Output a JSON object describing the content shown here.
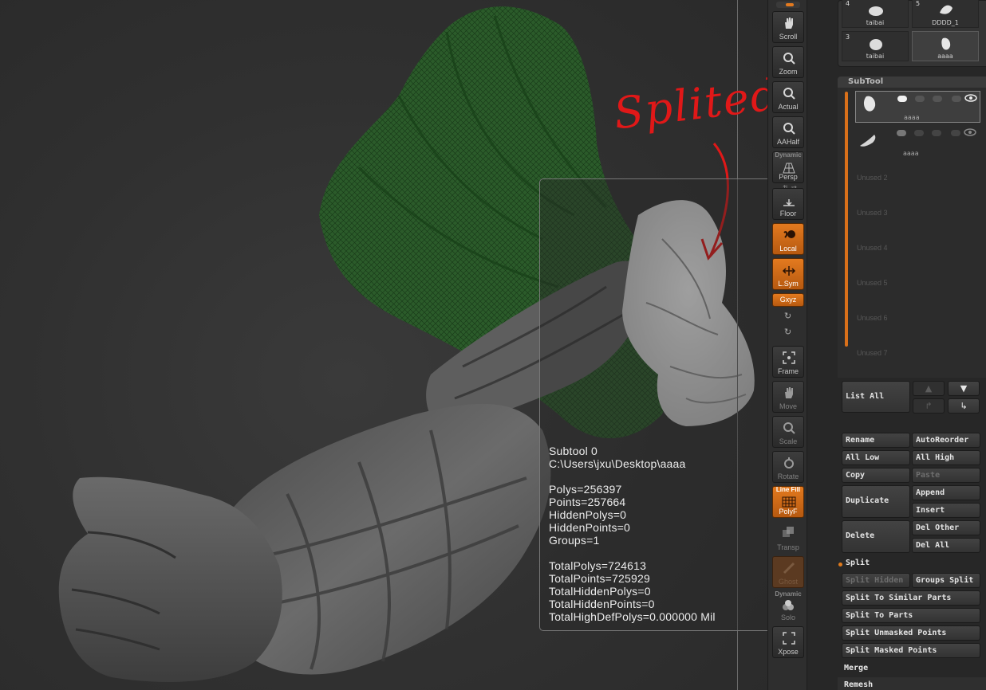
{
  "annotation": {
    "text": "Splited"
  },
  "info": {
    "subtool": "Subtool 0",
    "path": "C:\\Users\\jxu\\Desktop\\aaaa",
    "polys": "Polys=256397",
    "points": "Points=257664",
    "hidden_polys": "HiddenPolys=0",
    "hidden_points": "HiddenPoints=0",
    "groups": "Groups=1",
    "total_polys": "TotalPolys=724613",
    "total_points": "TotalPoints=725929",
    "total_hidden_polys": "TotalHiddenPolys=0",
    "total_hidden_points": "TotalHiddenPoints=0",
    "total_highdef": "TotalHighDefPolys=0.000000 Mil"
  },
  "shelf": {
    "scroll": "Scroll",
    "zoom": "Zoom",
    "actual": "Actual",
    "aahalf": "AAHalf",
    "persp_top": "Dynamic",
    "persp": "Persp",
    "floor": "Floor",
    "local": "Local",
    "lsym": "L.Sym",
    "xyz": "Gxyz",
    "frame": "Frame",
    "move": "Move",
    "scale": "Scale",
    "rotate": "Rotate",
    "polyf_top": "Line Fill",
    "polyf": "PolyF",
    "transp": "Transp",
    "ghost": "Ghost",
    "solo_top": "Dynamic",
    "solo": "Solo",
    "xpose": "Xpose"
  },
  "thumbs": [
    {
      "num": "4",
      "name": "taibai"
    },
    {
      "num": "5",
      "name": "DDDD_1"
    },
    {
      "num": "3",
      "name": "taibai"
    },
    {
      "num": "",
      "name": "aaaa"
    }
  ],
  "subtool": {
    "header": "SubTool",
    "items": [
      {
        "name": "aaaa"
      },
      {
        "name": "aaaa"
      }
    ],
    "unused": [
      "Unused 2",
      "Unused 3",
      "Unused 4",
      "Unused 5",
      "Unused 6",
      "Unused 7"
    ],
    "list_all": "List All",
    "rename": "Rename",
    "autoreorder": "AutoReorder",
    "all_low": "All Low",
    "all_high": "All High",
    "copy": "Copy",
    "paste": "Paste",
    "duplicate": "Duplicate",
    "append": "Append",
    "insert": "Insert",
    "delete": "Delete",
    "del_other": "Del Other",
    "del_all": "Del All",
    "split_label": "Split",
    "split_hidden": "Split Hidden",
    "groups_split": "Groups Split",
    "split_similar": "Split To Similar Parts",
    "split_parts": "Split To Parts",
    "split_unmasked": "Split Unmasked Points",
    "split_masked": "Split Masked Points",
    "merge": "Merge",
    "remesh": "Remesh"
  },
  "colors": {
    "accent": "#e37a1f",
    "annotation": "#e01818",
    "cloth": "#2d5a2a"
  }
}
